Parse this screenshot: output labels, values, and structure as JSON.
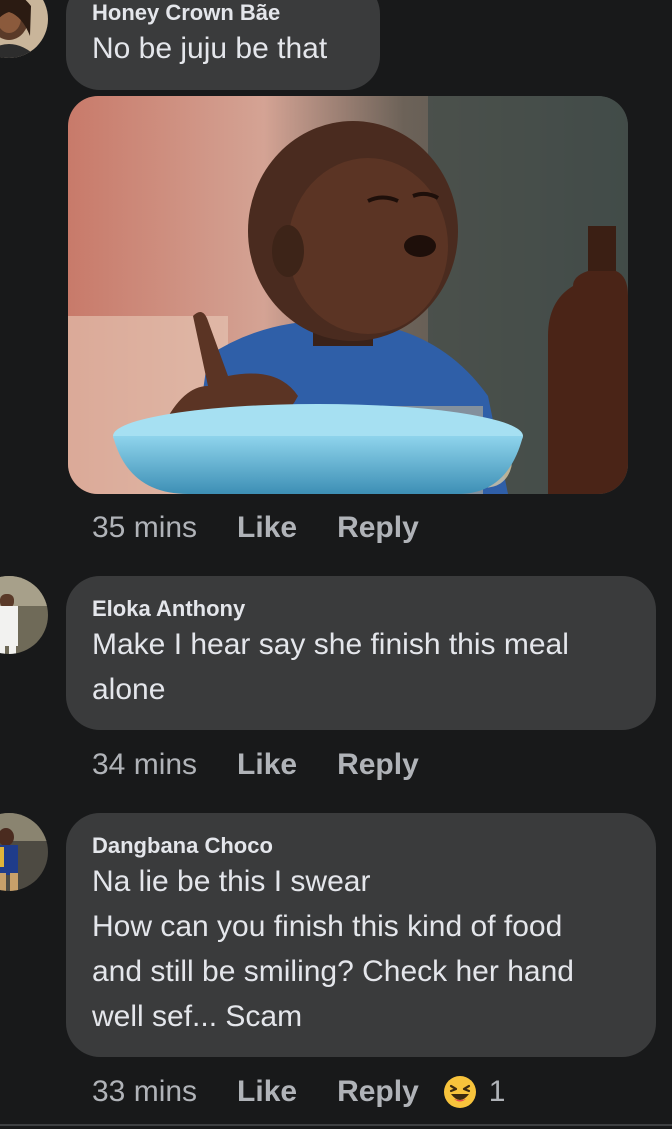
{
  "comments": [
    {
      "author": "Honey Crown Bãe",
      "text": "No be juju be that",
      "time": "35 mins",
      "like_label": "Like",
      "reply_label": "Reply"
    },
    {
      "author": "Eloka Anthony",
      "text": "Make I hear say she finish this meal\nalone",
      "time": "34 mins",
      "like_label": "Like",
      "reply_label": "Reply"
    },
    {
      "author": "Dangbana Choco",
      "text": "Na lie be this I swear\nHow can you finish this kind of food\nand still be smiling? Check her hand\nwell sef... Scam",
      "time": "33 mins",
      "like_label": "Like",
      "reply_label": "Reply",
      "reaction": {
        "icon": "laughing-emoji-icon",
        "count": "1"
      }
    }
  ],
  "colors": {
    "background": "#18191a",
    "bubble": "#3a3b3c",
    "text_primary": "#e4e6eb",
    "text_secondary": "#b0b3b8",
    "reaction": "#f7c33c"
  }
}
